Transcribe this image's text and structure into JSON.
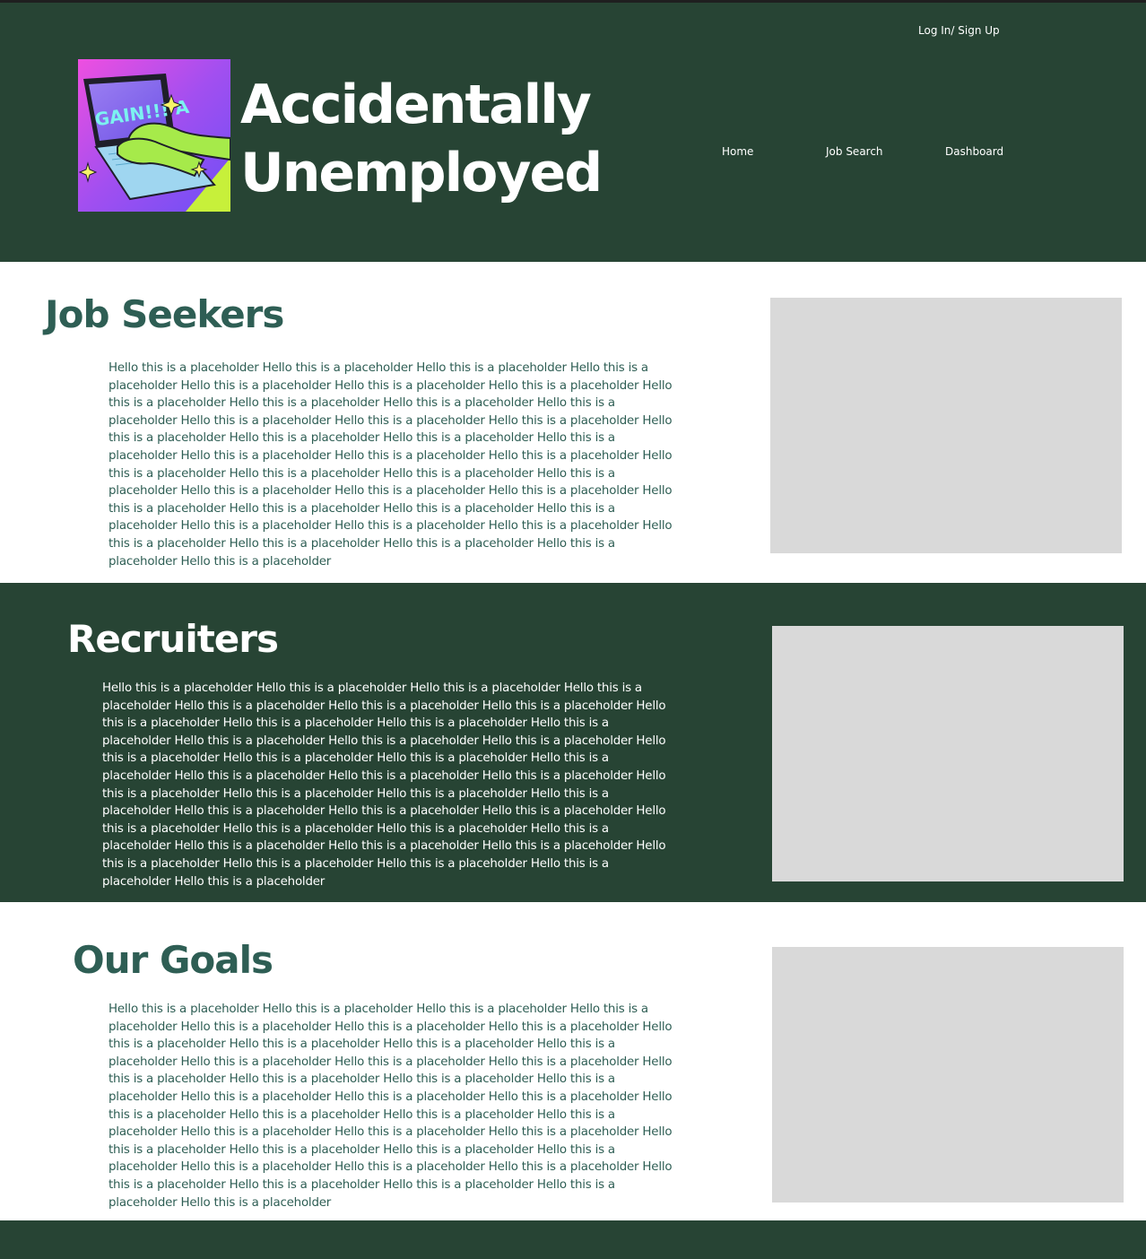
{
  "header": {
    "login_label": "Log In/ Sign Up",
    "title_line1": "Accidentally",
    "title_line2": "Unemployed",
    "logo": {
      "icon": "laptop-typing-illustration",
      "screen_text": "GAIN!!! A"
    },
    "nav": [
      {
        "label": "Home"
      },
      {
        "label": "Job Search"
      },
      {
        "label": "Dashboard"
      }
    ]
  },
  "sections": [
    {
      "heading": "Job Seekers",
      "body": "Hello this is a placeholder Hello this is a placeholder Hello this is a placeholder Hello this is a placeholder Hello this is a placeholder Hello this is a placeholder Hello this is a placeholder Hello this is a placeholder Hello this is a placeholder Hello this is a placeholder Hello this is a placeholder Hello this is a placeholder Hello this is a placeholder Hello this is a placeholder Hello this is a placeholder Hello this is a placeholder Hello this is a placeholder Hello this is a placeholder Hello this is a placeholder Hello this is a placeholder Hello this is a placeholder Hello this is a placeholder Hello this is a placeholder Hello this is a placeholder Hello this is a placeholder Hello this is a placeholder Hello this is a placeholder Hello this is a placeholder Hello this is a placeholder Hello this is a placeholder Hello this is a placeholder Hello this is a placeholder Hello this is a placeholder Hello this is a placeholder Hello this is a placeholder Hello this is a placeholder Hello this is a placeholder Hello this is a placeholder Hello this is a placeholder Hello this is a placeholder"
    },
    {
      "heading": "Recruiters",
      "body": "Hello this is a placeholder Hello this is a placeholder Hello this is a placeholder Hello this is a placeholder Hello this is a placeholder Hello this is a placeholder Hello this is a placeholder Hello this is a placeholder Hello this is a placeholder Hello this is a placeholder Hello this is a placeholder Hello this is a placeholder Hello this is a placeholder Hello this is a placeholder Hello this is a placeholder Hello this is a placeholder Hello this is a placeholder Hello this is a placeholder Hello this is a placeholder Hello this is a placeholder Hello this is a placeholder Hello this is a placeholder Hello this is a placeholder Hello this is a placeholder Hello this is a placeholder Hello this is a placeholder Hello this is a placeholder Hello this is a placeholder Hello this is a placeholder Hello this is a placeholder Hello this is a placeholder Hello this is a placeholder Hello this is a placeholder Hello this is a placeholder Hello this is a placeholder Hello this is a placeholder Hello this is a placeholder Hello this is a placeholder Hello this is a placeholder Hello this is a placeholder"
    },
    {
      "heading": "Our Goals",
      "body": "Hello this is a placeholder Hello this is a placeholder Hello this is a placeholder Hello this is a placeholder Hello this is a placeholder Hello this is a placeholder Hello this is a placeholder Hello this is a placeholder Hello this is a placeholder Hello this is a placeholder Hello this is a placeholder Hello this is a placeholder Hello this is a placeholder Hello this is a placeholder Hello this is a placeholder Hello this is a placeholder Hello this is a placeholder Hello this is a placeholder Hello this is a placeholder Hello this is a placeholder Hello this is a placeholder Hello this is a placeholder Hello this is a placeholder Hello this is a placeholder Hello this is a placeholder Hello this is a placeholder Hello this is a placeholder Hello this is a placeholder Hello this is a placeholder Hello this is a placeholder Hello this is a placeholder Hello this is a placeholder Hello this is a placeholder Hello this is a placeholder Hello this is a placeholder Hello this is a placeholder Hello this is a placeholder Hello this is a placeholder Hello this is a placeholder Hello this is a placeholder"
    }
  ],
  "colors": {
    "header_bg": "#274434",
    "accent_text": "#2e5e54",
    "placeholder_gray": "#d9d9d9"
  }
}
